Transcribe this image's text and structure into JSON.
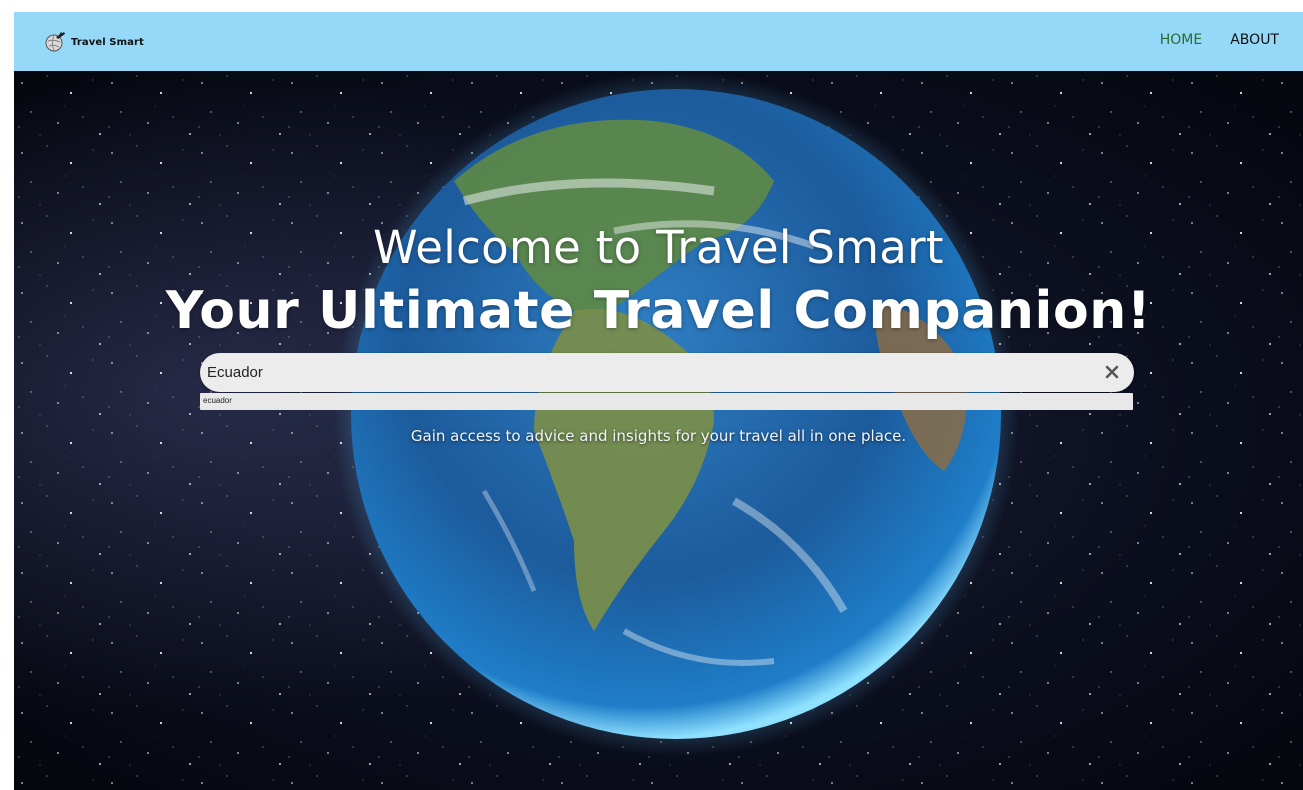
{
  "brand": {
    "name": "Travel Smart",
    "logo_icon": "airplane-globe-icon"
  },
  "nav": {
    "items": [
      {
        "label": "HOME",
        "active": true
      },
      {
        "label": "ABOUT",
        "active": false
      }
    ]
  },
  "hero": {
    "headline": "Welcome to Travel Smart",
    "subheadline": "Your Ultimate Travel Companion!",
    "tagline": "Gain access to advice and insights for your travel all in one place.",
    "background": "starfield-earth-image"
  },
  "search": {
    "value": "Ecuador",
    "placeholder": "",
    "clear_icon": "close-icon",
    "suggestions": [
      "ecuador"
    ]
  },
  "colors": {
    "navbar": "#95d8f7",
    "nav_active": "#2c6b34",
    "nav_text": "#111111",
    "search_bg": "#ececec"
  }
}
